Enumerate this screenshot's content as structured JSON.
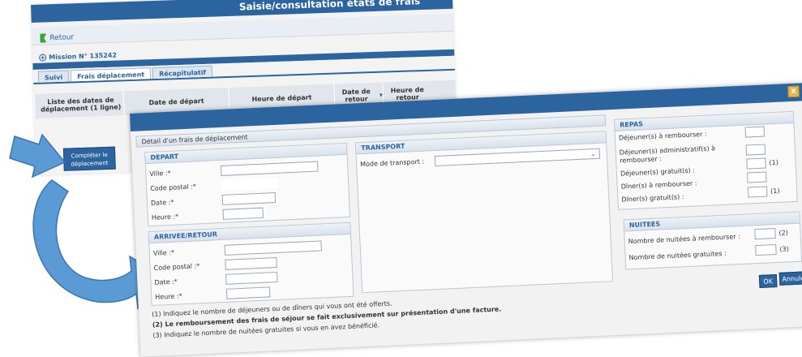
{
  "app": {
    "title": "Saisie/consultation états de frais",
    "back_label": "Retour",
    "mission_label": "Mission N° 135242",
    "tabs": [
      "Suivi",
      "Frais déplacement",
      "Récapitulatif"
    ],
    "list_title": "Liste des dates de déplacement (1 ligne)",
    "columns": [
      "Date de départ",
      "Heure de départ",
      "Date de retour",
      "Heure de retour"
    ],
    "complete_button": "Compléter le déplacement"
  },
  "modal": {
    "title": "Détail d'un frais de déplacement",
    "depart": {
      "heading": "DEPART",
      "fields": [
        "Ville :*",
        "Code postal :*",
        "Date :*",
        "Heure :*"
      ]
    },
    "arrivee": {
      "heading": "ARRIVEE/RETOUR",
      "fields": [
        "Ville :*",
        "Code postal :*",
        "Date :*",
        "Heure :*"
      ]
    },
    "transport": {
      "heading": "TRANSPORT",
      "mode_label": "Mode de transport :"
    },
    "repas": {
      "heading": "REPAS",
      "items": [
        "Déjeuner(s) à rembourser :",
        "Déjeuner(s) administratif(s) à rembourser :",
        "Déjeuner(s) gratuit(s) :",
        "Dîner(s) à rembourser :",
        "Dîner(s) gratuit(s) :"
      ],
      "marks": [
        "",
        "",
        "(1)",
        "",
        "(1)"
      ]
    },
    "nuitees": {
      "heading": "NUITEES",
      "items": [
        "Nombre de nuitées à rembourser :",
        "Nombre de nuitées gratuites :"
      ],
      "marks": [
        "(2)",
        "(3)"
      ]
    },
    "notes": [
      "(1) Indiquez le nombre de déjeuners ou de dîners qui vous ont été offerts.",
      "(2) Le remboursement des frais de séjour se fait exclusivement sur présentation d'une facture.",
      "(3) Indiquez le nombre de nuitées gratuites si vous en avez bénéficié."
    ],
    "ok_label": "OK",
    "cancel_label": "Annuler",
    "close_label": "x"
  },
  "colors": {
    "accent": "#2c64a0",
    "arrow": "#5b9bd5",
    "close": "#e6b84c"
  }
}
